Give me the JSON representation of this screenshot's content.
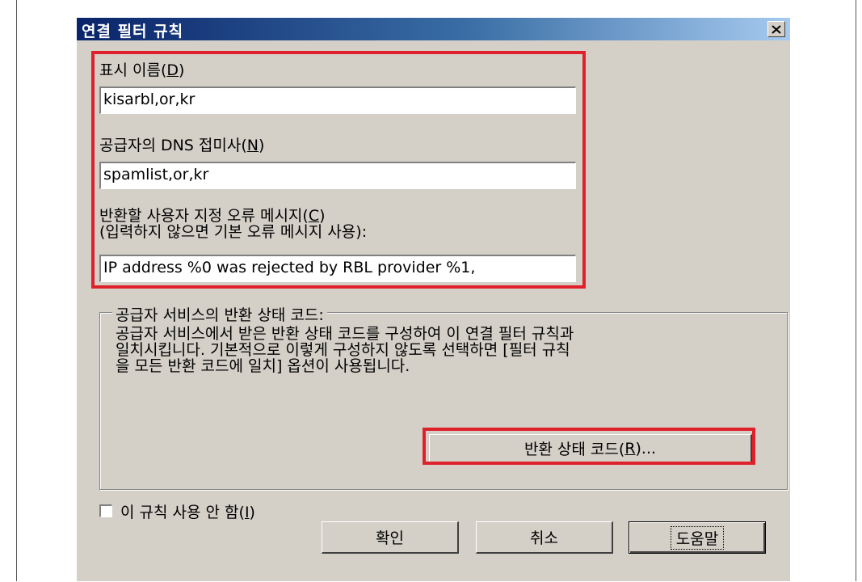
{
  "dialog": {
    "title": "연결 필터 규칙",
    "close_icon": "close-icon"
  },
  "fields": {
    "display_name": {
      "label_pre": "표시 이름(",
      "accel": "D",
      "label_post": ")",
      "value": "kisarbl,or,kr"
    },
    "dns_suffix": {
      "label_pre": "공급자의 DNS 접미사(",
      "accel": "N",
      "label_post": ")",
      "value": "spamlist,or,kr"
    },
    "error_message": {
      "label_pre": "반환할 사용자 지정 오류 메시지(",
      "accel": "C",
      "label_post": ")",
      "label_line2": "(입력하지 않으면 기본 오류 메시지 사용):",
      "value": "IP address %0 was rejected by RBL provider %1,"
    }
  },
  "status_group": {
    "legend": "공급자 서비스의 반환 상태 코드:",
    "description": "공급자 서비스에서 받은 반환 상태 코드를 구성하여 이 연결 필터 규칙과\n일치시킵니다. 기본적으로 이렇게 구성하지 않도록 선택하면 [필터 규칙\n을 모든 반환 코드에 일치] 옵션이 사용됩니다.",
    "button": {
      "label_pre": "반환 상태 코드(",
      "accel": "R",
      "label_post": ")..."
    }
  },
  "disable_rule": {
    "label_pre": "이 규칙 사용 안 함(",
    "accel": "I",
    "label_post": ")",
    "checked": false
  },
  "buttons": {
    "ok": "확인",
    "cancel": "취소",
    "help": "도움말"
  },
  "colors": {
    "highlight": "#e0202a",
    "dialog_bg": "#d4d0c8",
    "titlebar": "#0a246a"
  }
}
